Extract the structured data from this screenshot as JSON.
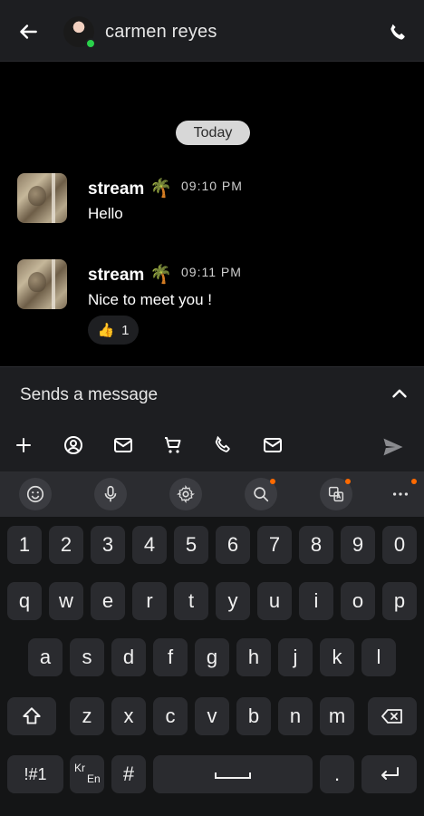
{
  "header": {
    "title": "carmen reyes"
  },
  "chat": {
    "date_label": "Today",
    "messages": [
      {
        "sender": "stream",
        "emoji": "🌴",
        "time": "09:10 PM",
        "text": "Hello"
      },
      {
        "sender": "stream",
        "emoji": "🌴",
        "time": "09:11 PM",
        "text": "Nice to meet you !",
        "reaction": {
          "emoji": "👍",
          "count": "1"
        }
      }
    ]
  },
  "composer": {
    "placeholder": "Sends a message",
    "tools": [
      "plus-icon",
      "contact-icon",
      "mail-icon",
      "cart-icon",
      "phone-icon",
      "mail-icon"
    ]
  },
  "keyboard": {
    "toolbar": [
      "emoji-icon",
      "mic-icon",
      "settings-icon",
      "search-icon",
      "translate-icon",
      "more-icon"
    ],
    "row1": [
      "1",
      "2",
      "3",
      "4",
      "5",
      "6",
      "7",
      "8",
      "9",
      "0"
    ],
    "row2": [
      "q",
      "w",
      "e",
      "r",
      "t",
      "y",
      "u",
      "i",
      "o",
      "p"
    ],
    "row3": [
      "a",
      "s",
      "d",
      "f",
      "g",
      "h",
      "j",
      "k",
      "l"
    ],
    "row4": [
      "z",
      "x",
      "c",
      "v",
      "b",
      "n",
      "m"
    ],
    "symbols_key": "!#1",
    "lang_top": "Kr",
    "lang_bottom": "En",
    "hash_key": "#",
    "period_key": "."
  },
  "colors": {
    "header_bg": "#1d1e21",
    "chat_bg": "#000000",
    "online": "#2ad14b",
    "keyboard_bg": "#141516",
    "key_bg": "#2a2b2f",
    "notification_dot": "#ff6a00"
  }
}
